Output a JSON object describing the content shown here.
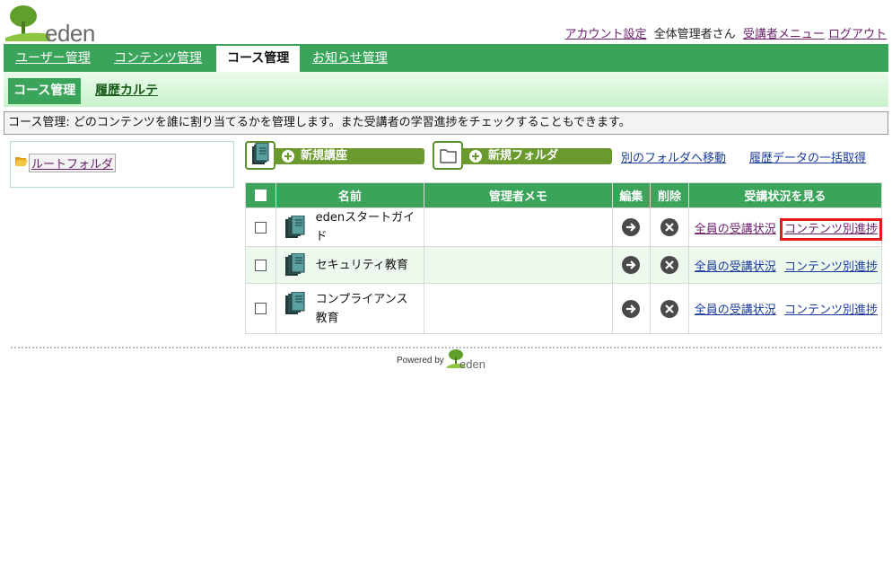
{
  "header": {
    "logo_text": "eden",
    "links": {
      "account": "アカウント設定",
      "user": "全体管理者さん",
      "learner_menu": "受講者メニュー",
      "logout": "ログアウト"
    }
  },
  "main_nav": {
    "tabs": [
      {
        "label": "ユーザー管理",
        "active": false
      },
      {
        "label": "コンテンツ管理",
        "active": false
      },
      {
        "label": "コース管理",
        "active": true
      },
      {
        "label": "お知らせ管理",
        "active": false
      }
    ]
  },
  "sub_nav": {
    "active": "コース管理",
    "link": "履歴カルテ"
  },
  "description": "コース管理: どのコンテンツを誰に割り当てるかを管理します。また受講者の学習進捗をチェックすることもできます。",
  "tree": {
    "root_label": "ルートフォルダ"
  },
  "toolbar": {
    "new_course": "新規講座",
    "new_folder": "新規フォルダ",
    "move": "別のフォルダへ移動",
    "bulk_history": "履歴データの一括取得"
  },
  "table": {
    "headers": {
      "name": "名前",
      "memo": "管理者メモ",
      "edit": "編集",
      "delete": "削除",
      "status": "受講状況を見る"
    },
    "rows": [
      {
        "name": "edenスタートガイド",
        "memo": "",
        "all_status": "全員の受講状況",
        "content_progress": "コンテンツ別進捗"
      },
      {
        "name": "セキュリティ教育",
        "memo": "",
        "all_status": "全員の受講状況",
        "content_progress": "コンテンツ別進捗"
      },
      {
        "name": "コンプライアンス教育",
        "memo": "",
        "all_status": "全員の受講状況",
        "content_progress": "コンテンツ別進捗"
      }
    ]
  },
  "footer": {
    "powered_by": "Powered by",
    "logo_text": "eden"
  },
  "colors": {
    "primary_green": "#3aa55a",
    "button_green": "#6a9a2e",
    "visited_link": "#6b1e6b",
    "link": "#1a3b9a",
    "highlight_red": "#e8191a"
  }
}
